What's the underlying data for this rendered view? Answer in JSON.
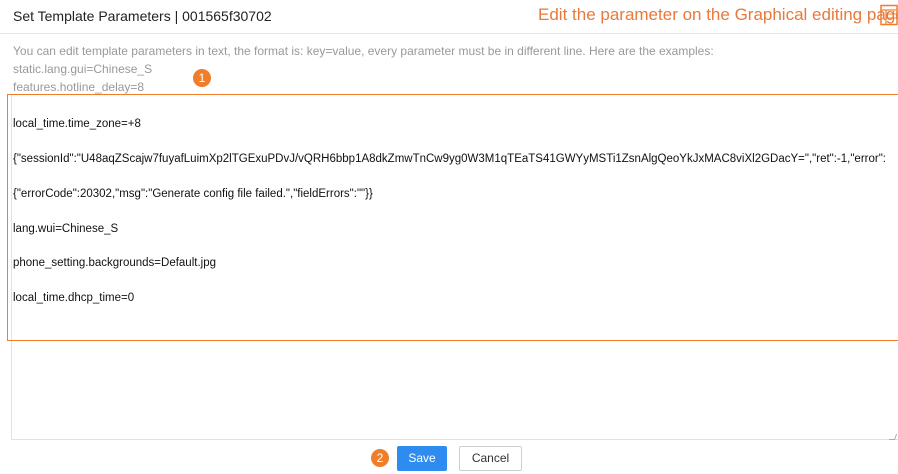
{
  "dialog": {
    "title": "Set Template Parameters | 001565f30702",
    "graphical_hint": "Edit the parameter on the Graphical editing page."
  },
  "instructions": {
    "text": "You can edit template parameters in text, the format is: key=value, every parameter must be in different line. Here are the examples:",
    "example_1": "static.lang.gui=Chinese_S",
    "example_2": "features.hotline_delay=8"
  },
  "editor": {
    "lines": [
      "local_time.time_zone=+8",
      "{\"sessionId\":\"U48aqZScajw7fuyafLuimXp2lTGExuPDvJ/vQRH6bbp1A8dkZmwTnCw9yg0W3M1qTEaTS41GWYyMSTi1ZsnAlgQeoYkJxMAC8viXl2GDacY=\",\"ret\":-1,\"error\":",
      "{\"errorCode\":20302,\"msg\":\"Generate config file failed.\",\"fieldErrors\":\"\"}}",
      "lang.wui=Chinese_S",
      "phone_setting.backgrounds=Default.jpg",
      "local_time.dhcp_time=0"
    ]
  },
  "badges": {
    "step_1": "1",
    "step_2": "2"
  },
  "footer": {
    "save_label": "Save",
    "cancel_label": "Cancel"
  },
  "colors": {
    "accent_orange": "#f07d2a",
    "primary_blue": "#2e8cf0"
  },
  "icons": {
    "graphical_editor": "template-grid-icon"
  }
}
